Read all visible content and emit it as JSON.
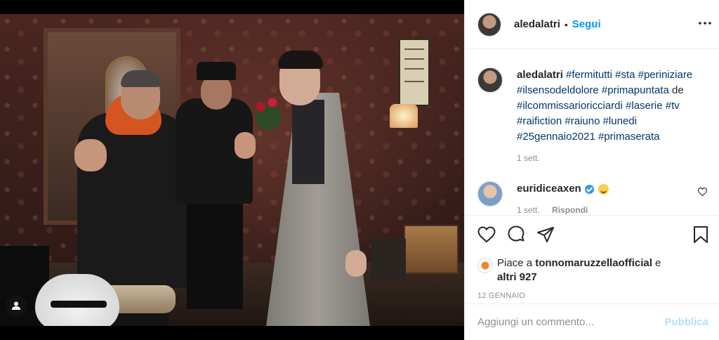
{
  "post": {
    "author": "aledalatri",
    "follow_label": "Segui",
    "separator": "•"
  },
  "caption": {
    "username": "aledalatri",
    "segments": [
      {
        "text": "#fermitutti",
        "tag": true
      },
      {
        "text": " ",
        "tag": false
      },
      {
        "text": "#sta",
        "tag": true
      },
      {
        "text": " ",
        "tag": false
      },
      {
        "text": "#periniziare",
        "tag": true
      },
      {
        "text": " ",
        "tag": false
      },
      {
        "text": "#ilsensodeldolore",
        "tag": true
      },
      {
        "text": " ",
        "tag": false
      },
      {
        "text": "#primapuntata",
        "tag": true
      },
      {
        "text": " de ",
        "tag": false
      },
      {
        "text": "#ilcommissarioricciardi",
        "tag": true
      },
      {
        "text": " ",
        "tag": false
      },
      {
        "text": "#laserie",
        "tag": true
      },
      {
        "text": " ",
        "tag": false
      },
      {
        "text": "#tv",
        "tag": true
      },
      {
        "text": " ",
        "tag": false
      },
      {
        "text": "#raifiction",
        "tag": true
      },
      {
        "text": " ",
        "tag": false
      },
      {
        "text": "#raiuno",
        "tag": true
      },
      {
        "text": " ",
        "tag": false
      },
      {
        "text": "#lunedi",
        "tag": true
      },
      {
        "text": " ",
        "tag": false
      },
      {
        "text": "#25gennaio2021",
        "tag": true
      },
      {
        "text": " ",
        "tag": false
      },
      {
        "text": "#primaserata",
        "tag": true
      }
    ],
    "time": "1 sett."
  },
  "comment": {
    "username": "euridiceaxen",
    "time": "1 sett.",
    "reply_label": "Rispondi"
  },
  "likes": {
    "prefix": "Piace a ",
    "liker": "tonnomaruzzellaofficial",
    "mid": " e",
    "others": "altri 927"
  },
  "date": "12 GENNAIO",
  "add_comment": {
    "placeholder": "Aggiungi un commento...",
    "publish_label": "Pubblica"
  },
  "colors": {
    "link": "#0095f6",
    "hashtag": "#00376b",
    "muted": "#8e8e8e",
    "publish_disabled": "#b2dffc",
    "verified": "#3897f0"
  }
}
